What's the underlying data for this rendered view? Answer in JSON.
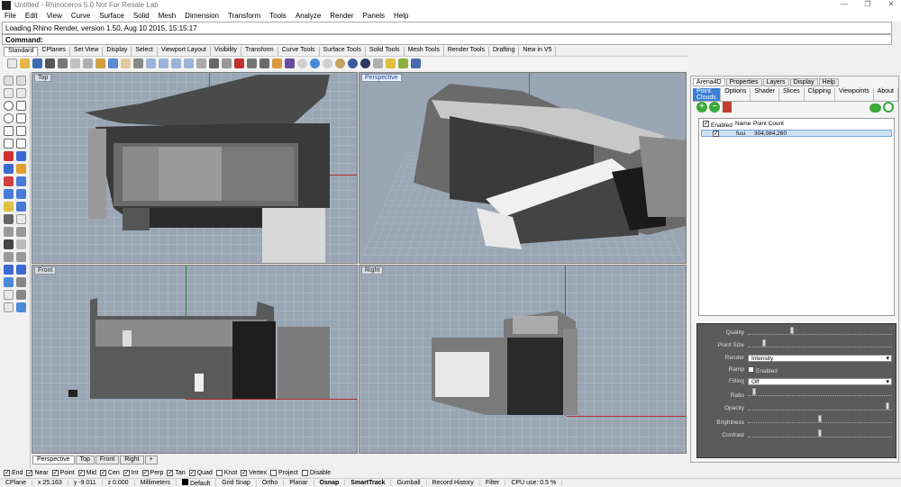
{
  "window": {
    "title": "Untitled - Rhinoceros 5.0 Not For Resale Lab"
  },
  "menu": [
    "File",
    "Edit",
    "View",
    "Curve",
    "Surface",
    "Solid",
    "Mesh",
    "Dimension",
    "Transform",
    "Tools",
    "Analyze",
    "Render",
    "Panels",
    "Help"
  ],
  "command": {
    "history": "Loading Rhino Render, version 1.50, Aug 10 2015, 15:15:17",
    "prompt": "Command:"
  },
  "toolbar_tabs": [
    "Standard",
    "CPlanes",
    "Set View",
    "Display",
    "Select",
    "Viewport Layout",
    "Visibility",
    "Transform",
    "Curve Tools",
    "Surface Tools",
    "Solid Tools",
    "Mesh Tools",
    "Render Tools",
    "Drafting",
    "New in V5"
  ],
  "viewports": {
    "top": "Top",
    "perspective": "Perspective",
    "front": "Front",
    "right": "Right"
  },
  "viewport_tabs": [
    "Perspective",
    "Top",
    "Front",
    "Right"
  ],
  "osnaps": [
    {
      "label": "End",
      "on": true
    },
    {
      "label": "Near",
      "on": true
    },
    {
      "label": "Point",
      "on": true
    },
    {
      "label": "Mid",
      "on": true
    },
    {
      "label": "Cen",
      "on": true
    },
    {
      "label": "Int",
      "on": true
    },
    {
      "label": "Perp",
      "on": true
    },
    {
      "label": "Tan",
      "on": true
    },
    {
      "label": "Quad",
      "on": true
    },
    {
      "label": "Knot",
      "on": false
    },
    {
      "label": "Vertex",
      "on": true
    },
    {
      "label": "Project",
      "on": false
    },
    {
      "label": "Disable",
      "on": false
    }
  ],
  "status": {
    "cplane": "CPlane",
    "x": "x 25.163",
    "y": "y -9.011",
    "z": "z 0.000",
    "units": "Millimeters",
    "layer": "Default",
    "grid_snap": "Grid Snap",
    "ortho": "Ortho",
    "planar": "Planar",
    "osnap": "Osnap",
    "smarttrack": "SmartTrack",
    "gumball": "Gumball",
    "record_history": "Record History",
    "filter": "Filter",
    "cpu": "CPU use: 0.5 %"
  },
  "panel": {
    "top_tabs": [
      "Arena4D",
      "Properties",
      "Layers",
      "Display",
      "Help"
    ],
    "sub_tabs": [
      "Point Clouds",
      "Options",
      "Shader",
      "Slices",
      "Clipping",
      "Viewpoints",
      "About"
    ],
    "table": {
      "headers": {
        "enabled": "Enabled",
        "name": "Name",
        "count": "Point Count"
      },
      "rows": [
        {
          "enabled": true,
          "name": "fusi",
          "count": "304,084,260"
        }
      ]
    },
    "properties": {
      "quality": {
        "label": "Quality",
        "value": 0.3
      },
      "point_size": {
        "label": "Point Size",
        "value": 0.1
      },
      "render": {
        "label": "Render",
        "value": "Intensity"
      },
      "ramp": {
        "label": "Ramp",
        "checkbox": "Enabled"
      },
      "filling": {
        "label": "Filling",
        "value": "Off"
      },
      "ratio": {
        "label": "Ratio",
        "value": 0.03
      },
      "opacity": {
        "label": "Opacity",
        "value": 0.98
      },
      "brightness": {
        "label": "Brightness",
        "value": 0.5
      },
      "contrast": {
        "label": "Contrast",
        "value": 0.5
      }
    }
  }
}
